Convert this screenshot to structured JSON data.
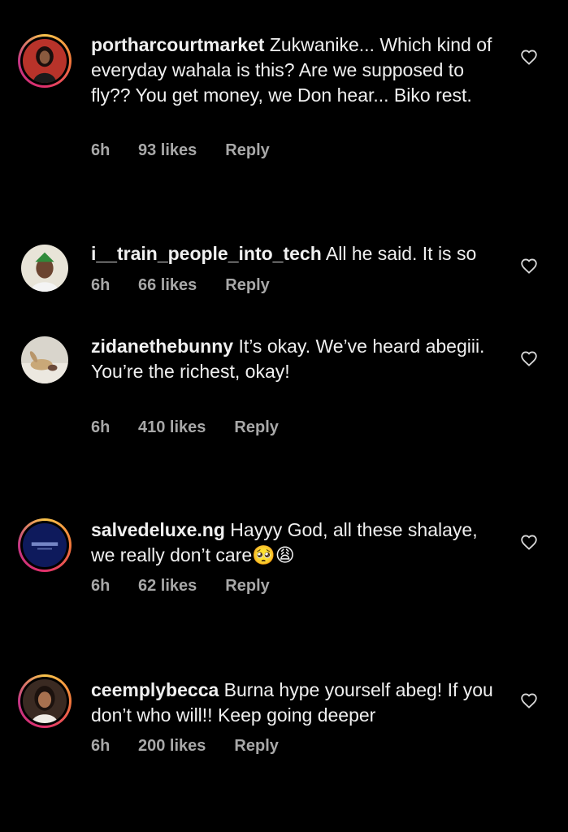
{
  "comments": [
    {
      "username": "portharcourtmarket",
      "text": " Zukwanike... Which kind of everyday wahala is this? Are we supposed to fly?? You get money, we Don hear... Biko rest.",
      "time": "6h",
      "likes": "93 likes",
      "reply": "Reply",
      "avatar": "woman-portrait",
      "story_ring": true
    },
    {
      "username": "i__train_people_into_tech",
      "text": " All he said. It is so",
      "time": "6h",
      "likes": "66 likes",
      "reply": "Reply",
      "avatar": "man-green-cap",
      "story_ring": false
    },
    {
      "username": "zidanethebunny",
      "text": " It’s okay. We’ve heard abegiii.\nYou’re the richest, okay!",
      "time": "6h",
      "likes": "410 likes",
      "reply": "Reply",
      "avatar": "stuffed-bunny",
      "story_ring": false
    },
    {
      "username": "salvedeluxe.ng",
      "text": " Hayyy God, all these shalaye, we really don’t care🥺😩",
      "time": "6h",
      "likes": "62 likes",
      "reply": "Reply",
      "avatar": "brand-logo",
      "story_ring": true
    },
    {
      "username": "ceemplybecca",
      "text": " Burna hype yourself abeg! If you don’t who will!! Keep going deeper",
      "time": "6h",
      "likes": "200 likes",
      "reply": "Reply",
      "avatar": "woman-portrait-2",
      "story_ring": true
    }
  ],
  "colors": {
    "background": "#000000",
    "text": "#f0f0f0",
    "meta": "#a8a8a8",
    "story_ring": [
      "#f9c54b",
      "#f2783a",
      "#e1306c",
      "#c13584"
    ]
  },
  "icons": {
    "like": "heart-outline-icon"
  }
}
